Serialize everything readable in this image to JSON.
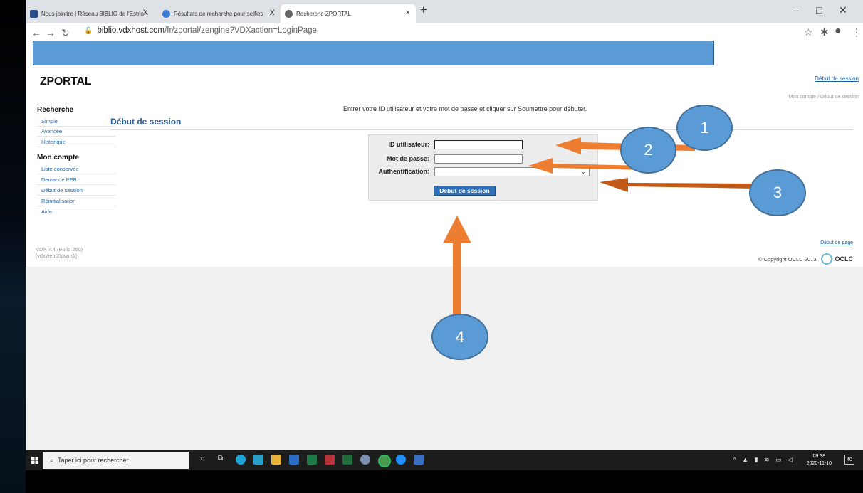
{
  "browser": {
    "tabs": [
      {
        "title": "Nous joindre | Réseau BIBLIO de l'Estrie",
        "close": "X"
      },
      {
        "title": "Résultats de recherche pour selfies",
        "close": "X"
      },
      {
        "title": "Recherche ZPORTAL",
        "close": "×"
      }
    ],
    "new_tab": "+",
    "url_host": "biblio.vdxhost.com",
    "url_path": "/fr/zportal/zengine?VDXaction=LoginPage"
  },
  "app": {
    "logo": "ZPORTAL",
    "top_link": "Début de session",
    "breadcrumb": "Mon compte / Début de session"
  },
  "sidebar": {
    "search_heading": "Recherche",
    "search_items": [
      "Simple",
      "Avancée",
      "Historique"
    ],
    "account_heading": "Mon compte",
    "account_items": [
      "Liste conservée",
      "Demande PEB",
      "Début de session",
      "Réinitialisation",
      "Aide"
    ]
  },
  "main": {
    "section_title": "Début de session",
    "instruction": "Entrer votre ID utilisateur et votre mot de passe et cliquer sur Soumettre pour débuter.",
    "form": {
      "user_label": "ID utilisateur:",
      "user_value": "",
      "pass_label": "Mot de passe:",
      "pass_value": "",
      "auth_label": "Authentification:",
      "auth_selected": "",
      "submit_label": "Début de session"
    }
  },
  "footer": {
    "version_line1": "VDX 7.4 (Build 250)",
    "version_line2": "[vdxweb05pwm1]",
    "top_of_page": "Début de page",
    "copyright": "© Copyright OCLC 2013.",
    "oclc": "OCLC"
  },
  "taskbar": {
    "search_placeholder": "Taper ici pour rechercher",
    "time": "09:38",
    "date": "2020-11-10",
    "notif_count": "40"
  },
  "annotations": {
    "callouts": [
      "1",
      "2",
      "3",
      "4"
    ],
    "arrow_color": "#ed7d31",
    "badge_color": "#5b9bd5"
  }
}
